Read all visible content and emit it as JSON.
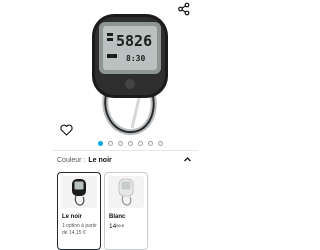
{
  "colors": {
    "accent": "#00a8e1",
    "selected_border": "#1f2a30",
    "device_body": "#1b1b1b",
    "lcd": "#b9c2c0",
    "carabiner": "#c0c4c6"
  },
  "header": {
    "share_icon": "share-icon"
  },
  "product": {
    "display_time": "5826",
    "display_bottom": "8:30"
  },
  "carousel": {
    "total": 7,
    "active_index": 0
  },
  "favorite_icon": "heart-icon",
  "variant": {
    "label": "Couleur :",
    "selected": "Le noir",
    "chevron_icon": "chevron-up-icon"
  },
  "swatches": [
    {
      "name": "Le noir",
      "sub": "1 option à partir de 14,15 €"
    },
    {
      "name": "Blanc",
      "price_main": "14",
      "price_frac": "99 €"
    }
  ]
}
